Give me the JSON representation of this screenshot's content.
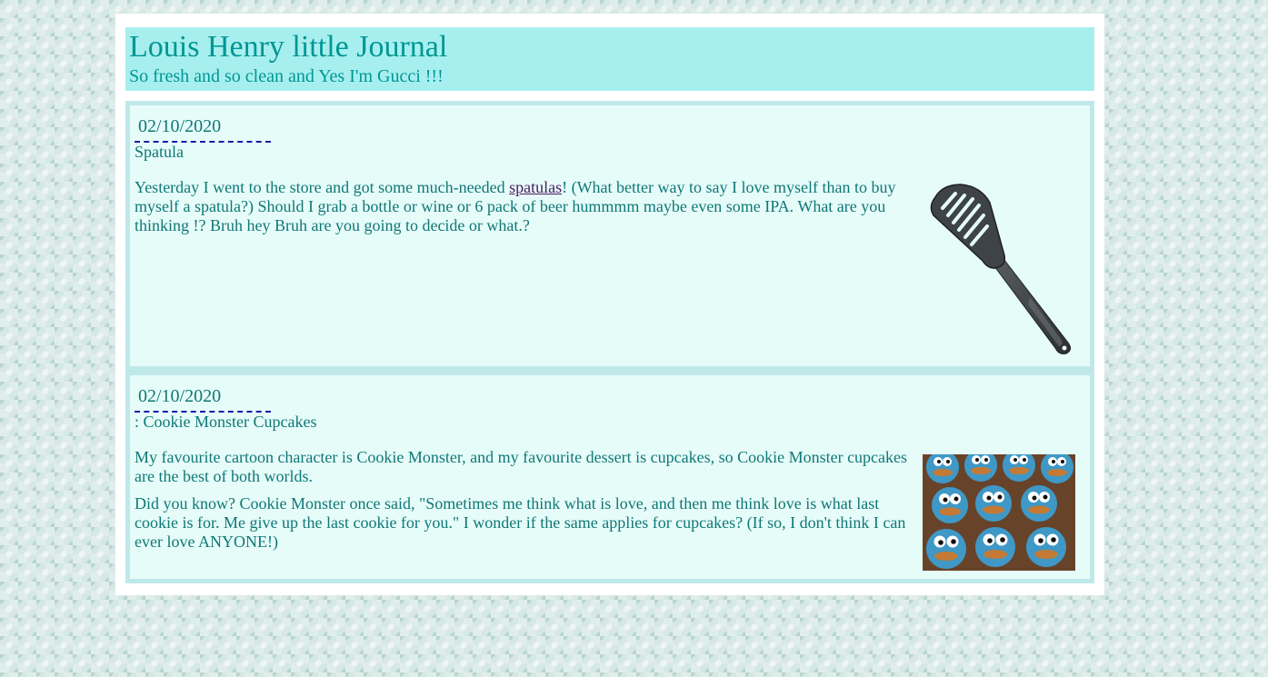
{
  "header": {
    "title": "Louis Henry little Journal",
    "subtitle": "So fresh and so clean and Yes I'm Gucci !!!"
  },
  "posts": [
    {
      "date": "02/10/2020",
      "title": "Spatula",
      "body_before_link": "Yesterday I went to the store and got some much-needed ",
      "link_text": "spatulas",
      "body_after_link": "! (What better way to say I love myself than to buy myself a spatula?) Should I grab a bottle or wine or 6 pack of beer hummmm maybe even some IPA. What are you thinking !? Bruh hey Bruh are you going to decide or what.?",
      "image": "spatula-image"
    },
    {
      "date": "02/10/2020",
      "title": ": Cookie Monster Cupcakes",
      "paragraph_1": "My favourite cartoon character is Cookie Monster, and my favourite dessert is cupcakes, so Cookie Monster cupcakes are the best of both worlds.",
      "paragraph_2": "Did you know? Cookie Monster once said, \"Sometimes me think what is love, and then me think love is what last cookie is for. Me give up the last cookie for you.\" I wonder if the same applies for cupcakes? (If so, I don't think I can ever love ANYONE!)",
      "image": "cookie-monster-cupcakes-image"
    }
  ],
  "colors": {
    "header_bg": "#a7efef",
    "accent_text": "#009694",
    "post_bg": "#e6fcf9",
    "post_border": "#bfe9e8",
    "post_text": "#0f7877",
    "link": "#4b1c60",
    "date_underline": "#1a1aa8"
  }
}
